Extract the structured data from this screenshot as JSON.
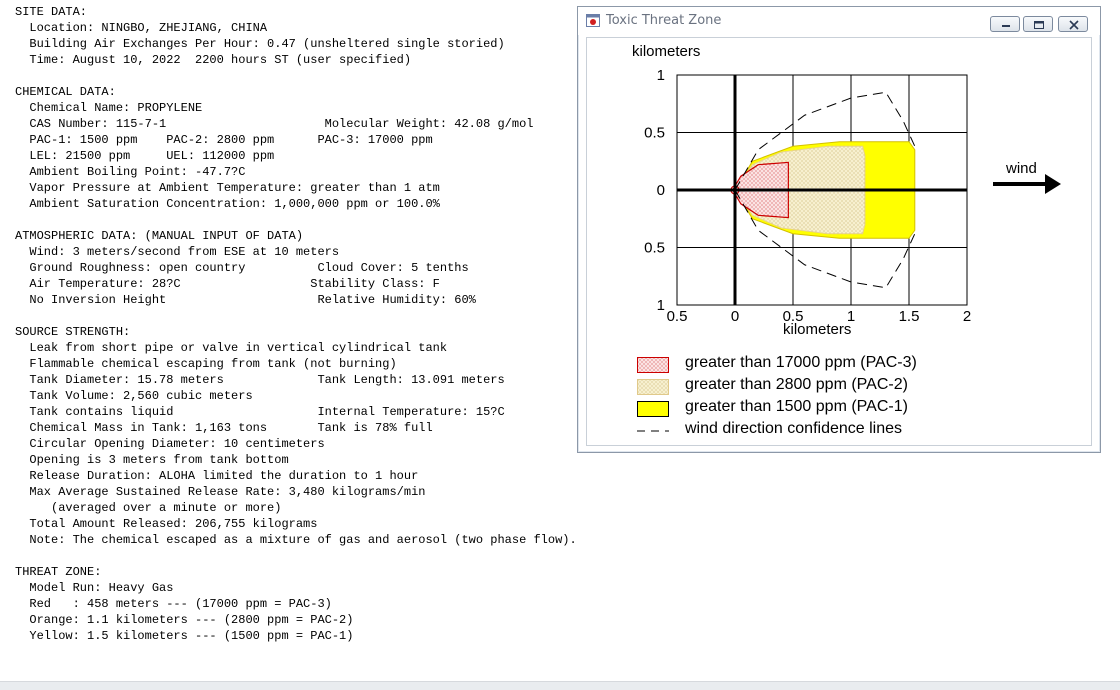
{
  "report": {
    "lines": [
      "SITE DATA:",
      "  Location: NINGBO, ZHEJIANG, CHINA",
      "  Building Air Exchanges Per Hour: 0.47 (unsheltered single storied)",
      "  Time: August 10, 2022  2200 hours ST (user specified)",
      "",
      "CHEMICAL DATA:",
      "  Chemical Name: PROPYLENE",
      "  CAS Number: 115-7-1                      Molecular Weight: 42.08 g/mol",
      "  PAC-1: 1500 ppm    PAC-2: 2800 ppm      PAC-3: 17000 ppm",
      "  LEL: 21500 ppm     UEL: 112000 ppm",
      "  Ambient Boiling Point: -47.7?C",
      "  Vapor Pressure at Ambient Temperature: greater than 1 atm",
      "  Ambient Saturation Concentration: 1,000,000 ppm or 100.0%",
      "",
      "ATMOSPHERIC DATA: (MANUAL INPUT OF DATA)",
      "  Wind: 3 meters/second from ESE at 10 meters",
      "  Ground Roughness: open country          Cloud Cover: 5 tenths",
      "  Air Temperature: 28?C                  Stability Class: F",
      "  No Inversion Height                     Relative Humidity: 60%",
      "",
      "SOURCE STRENGTH:",
      "  Leak from short pipe or valve in vertical cylindrical tank",
      "  Flammable chemical escaping from tank (not burning)",
      "  Tank Diameter: 15.78 meters             Tank Length: 13.091 meters",
      "  Tank Volume: 2,560 cubic meters",
      "  Tank contains liquid                    Internal Temperature: 15?C",
      "  Chemical Mass in Tank: 1,163 tons       Tank is 78% full",
      "  Circular Opening Diameter: 10 centimeters",
      "  Opening is 3 meters from tank bottom",
      "  Release Duration: ALOHA limited the duration to 1 hour",
      "  Max Average Sustained Release Rate: 3,480 kilograms/min",
      "     (averaged over a minute or more)",
      "  Total Amount Released: 206,755 kilograms",
      "  Note: The chemical escaped as a mixture of gas and aerosol (two phase flow).",
      "",
      "THREAT ZONE:",
      "  Model Run: Heavy Gas",
      "  Red   : 458 meters --- (17000 ppm = PAC-3)",
      "  Orange: 1.1 kilometers --- (2800 ppm = PAC-2)",
      "  Yellow: 1.5 kilometers --- (1500 ppm = PAC-1)"
    ]
  },
  "window": {
    "title": "Toxic Threat Zone",
    "icon": "aloha-app-icon",
    "controls": [
      "minimize-icon",
      "maximize-icon",
      "close-icon"
    ]
  },
  "chart_data": {
    "type": "area",
    "xlabel": "kilometers",
    "ylabel": "kilometers",
    "xlim": [
      -0.5,
      2
    ],
    "ylim": [
      -1,
      1
    ],
    "x_ticks": [
      "0.5",
      "0",
      "0.5",
      "1",
      "1.5",
      "2"
    ],
    "y_ticks": [
      "1",
      "0.5",
      "0",
      "0.5",
      "1"
    ],
    "grid": true,
    "wind_label": "wind",
    "zones": [
      {
        "name": "greater than 17000 ppm (PAC-3)",
        "color": "#f8d6d6",
        "edge": "#cc0000",
        "pattern": "dotted-red",
        "outline": [
          [
            -0.02,
            0
          ],
          [
            0.05,
            0.12
          ],
          [
            0.2,
            0.22
          ],
          [
            0.46,
            0.24
          ],
          [
            0.46,
            -0.24
          ],
          [
            0.2,
            -0.22
          ],
          [
            0.05,
            -0.12
          ],
          [
            -0.02,
            0
          ]
        ]
      },
      {
        "name": "greater than 2800 ppm (PAC-2)",
        "color": "#f4ecc4",
        "edge": "#e8d38a",
        "pattern": "dotted-tan",
        "outline": [
          [
            0,
            0
          ],
          [
            0.15,
            0.22
          ],
          [
            0.4,
            0.33
          ],
          [
            0.8,
            0.38
          ],
          [
            1.1,
            0.38
          ],
          [
            1.12,
            0.3
          ],
          [
            1.12,
            -0.3
          ],
          [
            1.1,
            -0.38
          ],
          [
            0.8,
            -0.38
          ],
          [
            0.4,
            -0.33
          ],
          [
            0.15,
            -0.22
          ],
          [
            0,
            0
          ]
        ]
      },
      {
        "name": "greater than 1500 ppm (PAC-1)",
        "color": "#ffff00",
        "edge": "#d4c000",
        "pattern": "solid",
        "outline": [
          [
            0,
            0
          ],
          [
            0.15,
            0.25
          ],
          [
            0.5,
            0.38
          ],
          [
            0.9,
            0.42
          ],
          [
            1.5,
            0.42
          ],
          [
            1.55,
            0.35
          ],
          [
            1.55,
            -0.35
          ],
          [
            1.5,
            -0.42
          ],
          [
            0.9,
            -0.42
          ],
          [
            0.5,
            -0.38
          ],
          [
            0.15,
            -0.25
          ],
          [
            0,
            0
          ]
        ]
      }
    ],
    "confidence_lines": {
      "name": "wind direction confidence lines",
      "upper": [
        [
          0,
          0
        ],
        [
          0.2,
          0.35
        ],
        [
          0.6,
          0.65
        ],
        [
          1.0,
          0.8
        ],
        [
          1.3,
          0.85
        ],
        [
          1.45,
          0.6
        ],
        [
          1.55,
          0.38
        ]
      ],
      "lower": [
        [
          0,
          0
        ],
        [
          0.2,
          -0.35
        ],
        [
          0.6,
          -0.65
        ],
        [
          1.0,
          -0.8
        ],
        [
          1.3,
          -0.85
        ],
        [
          1.45,
          -0.6
        ],
        [
          1.55,
          -0.38
        ]
      ]
    }
  }
}
